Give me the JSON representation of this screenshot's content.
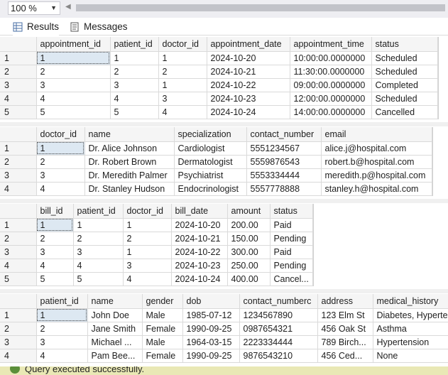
{
  "toolbar": {
    "zoom_value": "100 %"
  },
  "tabs": [
    {
      "label": "Results",
      "icon": "grid-icon",
      "active": true
    },
    {
      "label": "Messages",
      "icon": "messages-icon",
      "active": false
    }
  ],
  "grids": [
    {
      "name": "appointments-grid",
      "columns": [
        "appointment_id",
        "patient_id",
        "doctor_id",
        "appointment_date",
        "appointment_time",
        "status"
      ],
      "rows": [
        [
          "1",
          "1",
          "1",
          "2024-10-20",
          "10:00:00.0000000",
          "Scheduled"
        ],
        [
          "2",
          "2",
          "2",
          "2024-10-21",
          "11:30:00.0000000",
          "Scheduled"
        ],
        [
          "3",
          "3",
          "1",
          "2024-10-22",
          "09:00:00.0000000",
          "Completed"
        ],
        [
          "4",
          "4",
          "3",
          "2024-10-23",
          "12:00:00.0000000",
          "Scheduled"
        ],
        [
          "5",
          "5",
          "4",
          "2024-10-24",
          "14:00:00.0000000",
          "Cancelled"
        ]
      ]
    },
    {
      "name": "doctors-grid",
      "columns": [
        "doctor_id",
        "name",
        "specialization",
        "contact_number",
        "email"
      ],
      "rows": [
        [
          "1",
          "Dr. Alice Johnson",
          "Cardiologist",
          "5551234567",
          "alice.j@hospital.com"
        ],
        [
          "2",
          "Dr. Robert Brown",
          "Dermatologist",
          "5559876543",
          "robert.b@hospital.com"
        ],
        [
          "3",
          "Dr. Meredith Palmer",
          "Psychiatrist",
          "5553334444",
          "meredith.p@hospital.com"
        ],
        [
          "4",
          "Dr. Stanley Hudson",
          "Endocrinologist",
          "5557778888",
          "stanley.h@hospital.com"
        ]
      ]
    },
    {
      "name": "bills-grid",
      "columns": [
        "bill_id",
        "patient_id",
        "doctor_id",
        "bill_date",
        "amount",
        "status"
      ],
      "rows": [
        [
          "1",
          "1",
          "1",
          "2024-10-20",
          "200.00",
          "Paid"
        ],
        [
          "2",
          "2",
          "2",
          "2024-10-21",
          "150.00",
          "Pending"
        ],
        [
          "3",
          "3",
          "1",
          "2024-10-22",
          "300.00",
          "Paid"
        ],
        [
          "4",
          "4",
          "3",
          "2024-10-23",
          "250.00",
          "Pending"
        ],
        [
          "5",
          "5",
          "4",
          "2024-10-24",
          "400.00",
          "Cancel..."
        ]
      ]
    },
    {
      "name": "patients-grid",
      "columns": [
        "patient_id",
        "name",
        "gender",
        "dob",
        "contact_numberc",
        "address",
        "medical_history"
      ],
      "rows": [
        [
          "1",
          "John Doe",
          "Male",
          "1985-07-12",
          "1234567890",
          "123 Elm St",
          "Diabetes, Hyperte"
        ],
        [
          "2",
          "Jane Smith",
          "Female",
          "1990-09-25",
          "0987654321",
          "456 Oak St",
          "Asthma"
        ],
        [
          "3",
          "Michael ...",
          "Male",
          "1964-03-15",
          "2223334444",
          "789 Birch...",
          "Hypertension"
        ],
        [
          "4",
          "Pam Bee...",
          "Female",
          "1990-09-25",
          "9876543210",
          "456 Ced...",
          "None"
        ]
      ]
    }
  ],
  "status": {
    "text": "Query executed successfully."
  },
  "colors": {
    "status_bar": "#e9e8b5",
    "selected_cell": "#dde8f2"
  }
}
